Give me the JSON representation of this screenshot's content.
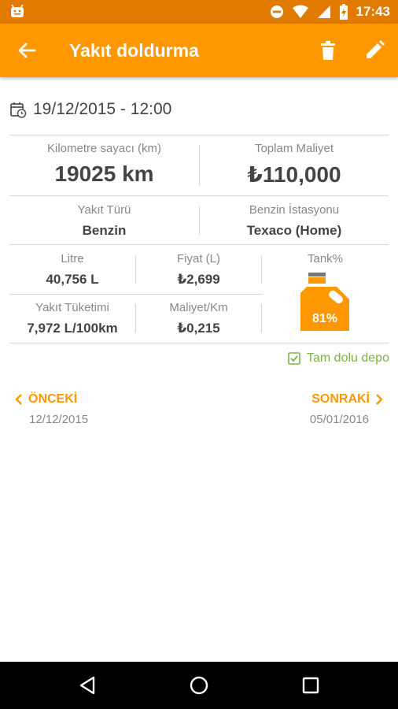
{
  "status_bar": {
    "time": "17:43"
  },
  "app_bar": {
    "title": "Yakıt doldurma"
  },
  "entry": {
    "datetime": "19/12/2015 - 12:00"
  },
  "odometer": {
    "label": "Kilometre sayacı (km)",
    "value": "19025 km"
  },
  "total_cost": {
    "label": "Toplam Maliyet",
    "value": "₺110,000"
  },
  "fuel_type": {
    "label": "Yakıt Türü",
    "value": "Benzin"
  },
  "station": {
    "label": "Benzin İstasyonu",
    "value": "Texaco (Home)"
  },
  "liters": {
    "label": "Litre",
    "value": "40,756 L"
  },
  "price": {
    "label": "Fiyat (L)",
    "value": "₺2,699"
  },
  "consumption": {
    "label": "Yakıt Tüketimi",
    "value": "7,972 L/100km"
  },
  "cost_per_km": {
    "label": "Maliyet/Km",
    "value": "₺0,215"
  },
  "tank": {
    "label": "Tank%",
    "value": "81%",
    "level": 0.81
  },
  "full_tank": {
    "label": "Tam dolu depo",
    "checked": true
  },
  "navigation": {
    "prev_label": "ÖNCEKİ",
    "prev_date": "12/12/2015",
    "next_label": "SONRAKİ",
    "next_date": "05/01/2016"
  },
  "colors": {
    "primary": "#ff9800",
    "primary_dark": "#e07a00",
    "accent_green": "#7cb342"
  },
  "icons": {
    "status_left": "android-icon",
    "do_not_disturb": "do-not-disturb-icon",
    "wifi": "wifi-icon",
    "signal": "cellular-signal-icon",
    "battery": "battery-charging-icon",
    "back": "arrow-back-icon",
    "delete": "trash-icon",
    "edit": "pencil-icon",
    "calendar": "calendar-clock-icon",
    "fuel_can": "fuel-can-icon",
    "checkbox": "checkbox-checked-icon",
    "prev": "chevron-left-icon",
    "next": "chevron-right-icon",
    "nav_back": "nav-back-triangle-icon",
    "nav_home": "nav-home-circle-icon",
    "nav_recents": "nav-recents-square-icon"
  }
}
